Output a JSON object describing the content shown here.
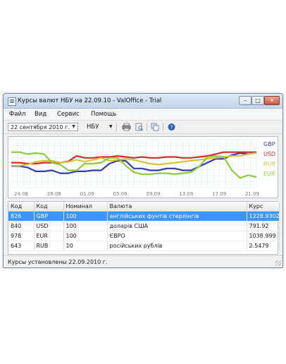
{
  "window": {
    "title": "Курсы валют НБУ на 22.09.10 - ValOffice - Trial",
    "controls": {
      "minimize": "–",
      "maximize": "□",
      "close": "✕"
    }
  },
  "menu": [
    "Файл",
    "Вид",
    "Сервис",
    "Помощь"
  ],
  "toolbar": {
    "date_value": "22 сентября 2010 г.",
    "bank_value": "НБУ",
    "icons": [
      "printer-icon",
      "print-preview-icon",
      "copy-icon",
      "help-icon"
    ]
  },
  "chart_data": {
    "type": "line",
    "x_ticks": [
      "24.08",
      "28.08",
      "01.09",
      "05.09",
      "09.09",
      "13.09",
      "17.09",
      "21.09"
    ],
    "grid": true,
    "legend_position": "right",
    "series": [
      {
        "name": "GBP",
        "color": "#3a3aa6",
        "values": [
          0.45,
          0.45,
          0.42,
          0.34,
          0.34,
          0.36,
          0.3,
          0.3,
          0.34,
          0.34,
          0.36,
          0.36,
          0.5,
          0.56,
          0.56,
          0.4,
          0.4,
          0.36,
          0.36,
          0.4,
          0.4,
          0.36,
          0.36,
          0.44,
          0.52,
          0.6,
          0.6,
          0.68,
          0.72,
          0.7,
          0.74
        ]
      },
      {
        "name": "USD",
        "color": "#d42a2a",
        "values": [
          0.52,
          0.52,
          0.5,
          0.5,
          0.52,
          0.52,
          0.52,
          0.55,
          0.66,
          0.62,
          0.62,
          0.64,
          0.64,
          0.66,
          0.64,
          0.62,
          0.64,
          0.62,
          0.62,
          0.64,
          0.64,
          0.62,
          0.62,
          0.64,
          0.66,
          0.7,
          0.74,
          0.74,
          0.74,
          0.74,
          0.74
        ]
      },
      {
        "name": "RUB",
        "color": "#d8c43c",
        "values": [
          0.46,
          0.46,
          0.48,
          0.54,
          0.56,
          0.56,
          0.52,
          0.54,
          0.58,
          0.54,
          0.58,
          0.62,
          0.56,
          0.58,
          0.6,
          0.58,
          0.54,
          0.5,
          0.48,
          0.5,
          0.52,
          0.54,
          0.56,
          0.58,
          0.6,
          0.62,
          0.64,
          0.66,
          0.66,
          0.7,
          0.72
        ]
      },
      {
        "name": "EUR",
        "color": "#8ccc3c",
        "values": [
          0.74,
          0.74,
          0.7,
          0.72,
          0.7,
          0.52,
          0.48,
          0.36,
          0.36,
          0.5,
          0.5,
          0.52,
          0.62,
          0.62,
          0.46,
          0.32,
          0.28,
          0.28,
          0.3,
          0.3,
          0.28,
          0.3,
          0.32,
          0.44,
          0.64,
          0.66,
          0.64,
          0.36,
          0.2,
          0.26,
          0.22
        ]
      }
    ]
  },
  "table": {
    "headers": [
      "Код",
      "Код",
      "Номинал",
      "Валюта",
      "Курс"
    ],
    "rows": [
      {
        "num": "826",
        "code": "GBP",
        "nominal": "100",
        "name": "англійських фунтів стерлінгів",
        "rate": "1228.9302",
        "selected": true
      },
      {
        "num": "840",
        "code": "USD",
        "nominal": "100",
        "name": "доларів США",
        "rate": "791.92",
        "selected": false
      },
      {
        "num": "978",
        "code": "EUR",
        "nominal": "100",
        "name": "ЄВРО",
        "rate": "1038.999",
        "selected": false
      },
      {
        "num": "643",
        "code": "RUB",
        "nominal": "10",
        "name": "російських рублів",
        "rate": "2.5479",
        "selected": false
      }
    ]
  },
  "status": {
    "text": "Курсы установлены 22.09.2010 г."
  }
}
